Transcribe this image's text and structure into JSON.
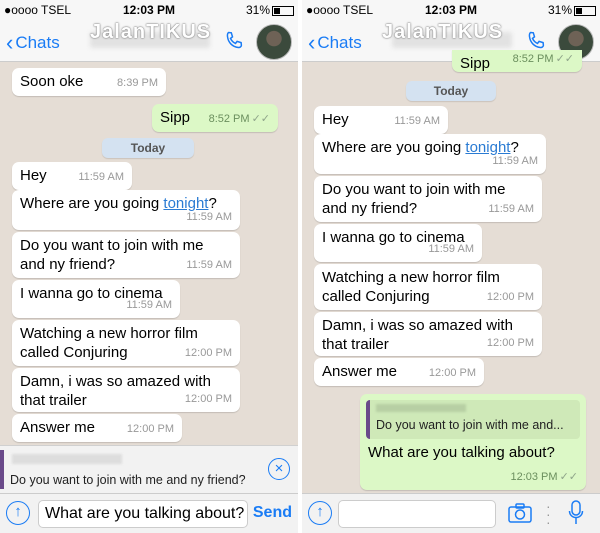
{
  "status": {
    "carrier": "●oooo TSEL",
    "time": "12:03 PM",
    "battery": "31%"
  },
  "nav": {
    "back_label": "Chats",
    "watermark": "JalanTIKUS"
  },
  "left": {
    "messages": [
      {
        "text": "Soon oke",
        "time": "8:39 PM"
      },
      {
        "text": "Sipp",
        "time": "8:52 PM"
      },
      {
        "text": "Today"
      },
      {
        "text": "Hey",
        "time": "11:59 AM"
      },
      {
        "text_before": "Where are you going ",
        "link": "tonight",
        "text_after": "?",
        "time": "11:59 AM"
      },
      {
        "text": "Do you want to join with me and ny friend?",
        "time": "11:59 AM"
      },
      {
        "text": "I wanna go to cinema",
        "time": "11:59 AM"
      },
      {
        "text": "Watching a new horror film called Conjuring",
        "time": "12:00 PM"
      },
      {
        "text": "Damn, i was so amazed with that trailer",
        "time": "12:00 PM"
      },
      {
        "text": "Answer me",
        "time": "12:00 PM"
      }
    ],
    "reply_preview": "Do you want to join with me and ny friend?",
    "input_value": "What are you talking about?",
    "send_label": "Send"
  },
  "right": {
    "messages": [
      {
        "text": "Sipp",
        "time": "8:52 PM"
      },
      {
        "text": "Today"
      },
      {
        "text": "Hey",
        "time": "11:59 AM"
      },
      {
        "text_before": "Where are you going ",
        "link": "tonight",
        "text_after": "?",
        "time": "11:59 AM"
      },
      {
        "text": "Do you want to join with me and ny friend?",
        "time": "11:59 AM"
      },
      {
        "text": "I wanna go to cinema",
        "time": "11:59 AM"
      },
      {
        "text": "Watching a new horror film called Conjuring",
        "time": "12:00 PM"
      },
      {
        "text": "Damn, i was so amazed with that trailer",
        "time": "12:00 PM"
      },
      {
        "text": "Answer me",
        "time": "12:00 PM"
      },
      {
        "quote": "Do you want to join with me and...",
        "text": "What are you talking about?",
        "time": "12:03 PM"
      }
    ],
    "input_value": ""
  },
  "colors": {
    "accent": "#1a7cf5",
    "incoming": "#ffffff",
    "outgoing": "#dcf8c6",
    "background": "#e5ddd5"
  },
  "icons": [
    "phone-icon",
    "back-chevron-icon",
    "close-circle-icon",
    "upload-arrow-icon",
    "camera-icon",
    "microphone-icon",
    "double-check-icon"
  ]
}
